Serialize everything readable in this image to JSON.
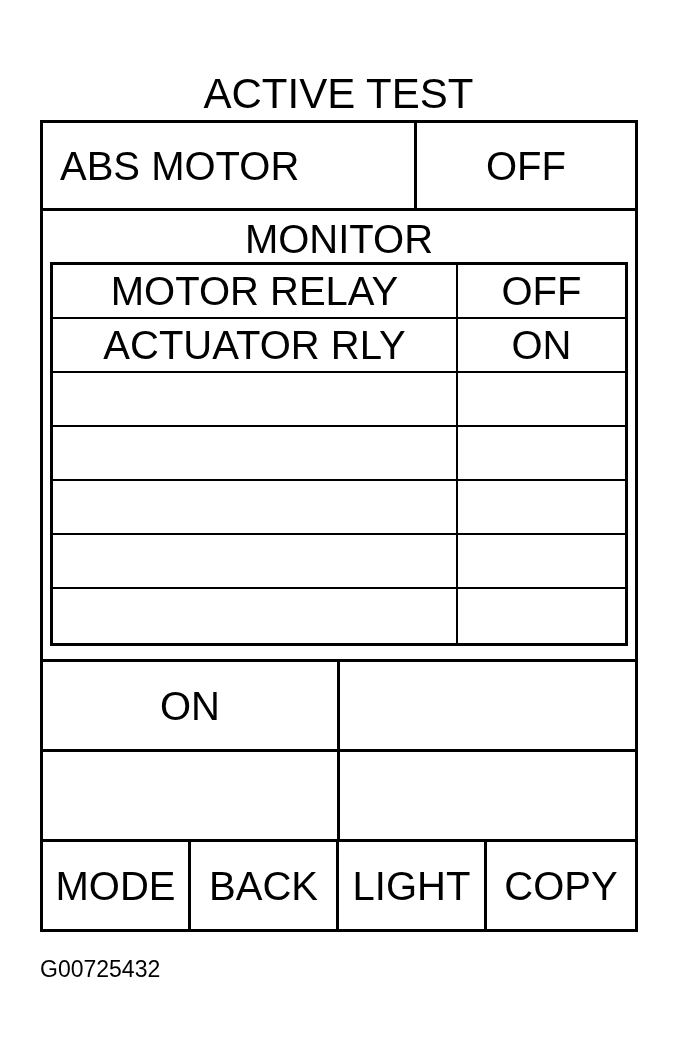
{
  "title": "ACTIVE TEST",
  "active_test": {
    "item": "ABS MOTOR",
    "value": "OFF"
  },
  "monitor": {
    "heading": "MONITOR",
    "rows": [
      {
        "item": "MOTOR RELAY",
        "value": "OFF"
      },
      {
        "item": "ACTUATOR RLY",
        "value": "ON"
      }
    ]
  },
  "status_cells": [
    "ON"
  ],
  "buttons": [
    "MODE",
    "BACK",
    "LIGHT",
    "COPY"
  ],
  "figure_code": "G00725432"
}
